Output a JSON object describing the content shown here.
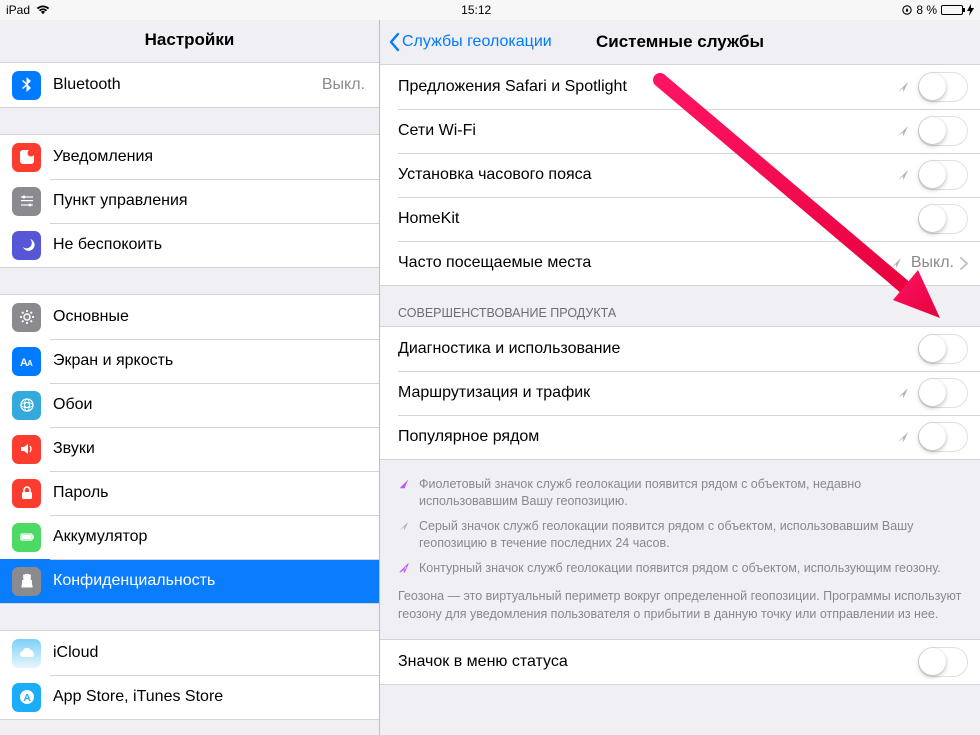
{
  "status": {
    "device": "iPad",
    "time": "15:12",
    "battery_pct": "8 %"
  },
  "sidebar": {
    "title": "Настройки",
    "groups": [
      {
        "items": [
          {
            "key": "bluetooth",
            "label": "Bluetooth",
            "value": "Выкл."
          }
        ]
      },
      {
        "items": [
          {
            "key": "notifications",
            "label": "Уведомления"
          },
          {
            "key": "control-center",
            "label": "Пункт управления"
          },
          {
            "key": "dnd",
            "label": "Не беспокоить"
          }
        ]
      },
      {
        "items": [
          {
            "key": "general",
            "label": "Основные"
          },
          {
            "key": "display",
            "label": "Экран и яркость"
          },
          {
            "key": "wallpaper",
            "label": "Обои"
          },
          {
            "key": "sounds",
            "label": "Звуки"
          },
          {
            "key": "passcode",
            "label": "Пароль"
          },
          {
            "key": "battery",
            "label": "Аккумулятор"
          },
          {
            "key": "privacy",
            "label": "Конфиденциальность",
            "selected": true
          }
        ]
      },
      {
        "items": [
          {
            "key": "icloud",
            "label": "iCloud"
          },
          {
            "key": "appstore",
            "label": "App Store, iTunes Store"
          }
        ]
      }
    ]
  },
  "detail": {
    "back_label": "Службы геолокации",
    "title": "Системные службы",
    "group1": [
      {
        "label": "Предложения Safari и Spotlight",
        "loc": "gray",
        "toggle": false
      },
      {
        "label": "Сети Wi-Fi",
        "loc": "gray",
        "toggle": false
      },
      {
        "label": "Установка часового пояса",
        "loc": "gray",
        "toggle": false
      },
      {
        "label": "HomeKit",
        "toggle": false
      },
      {
        "label": "Часто посещаемые места",
        "loc": "gray",
        "value": "Выкл.",
        "link": true
      }
    ],
    "section2_header": "Совершенствование продукта",
    "group2": [
      {
        "label": "Диагностика и использование",
        "toggle": false
      },
      {
        "label": "Маршрутизация и трафик",
        "loc": "gray",
        "toggle": false
      },
      {
        "label": "Популярное рядом",
        "loc": "gray",
        "toggle": false
      }
    ],
    "footer": [
      {
        "icon": "purple",
        "text": "Фиолетовый значок служб геолокации появится рядом с объектом, недавно использовавшим Вашу геопозицию."
      },
      {
        "icon": "gray",
        "text": "Серый значок служб геолокации появится рядом с объектом, использовавшим Вашу геопозицию в течение последних 24 часов."
      },
      {
        "icon": "outline",
        "text": "Контурный значок служб геолокации появится рядом с объектом, использующим геозону."
      }
    ],
    "footer_plain": "Геозона — это виртуальный периметр вокруг определенной геопозиции. Программы используют геозону для уведомления пользователя о прибытии в данную точку или отправлении из нее.",
    "group3": [
      {
        "label": "Значок в меню статуса",
        "toggle": false
      }
    ]
  }
}
